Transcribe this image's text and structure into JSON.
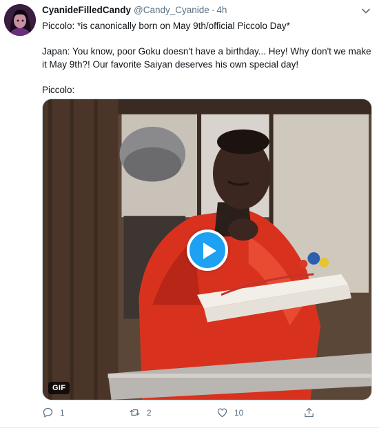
{
  "tweet": {
    "author": {
      "display_name": "CyanideFilledCandy",
      "handle": "@Candy_Cyanide",
      "separator": "·",
      "time": "4h",
      "avatar_icon": "avatar-image"
    },
    "menu_icon": "chevron-down-icon",
    "text": {
      "line1": "Piccolo: *is canonically born on May 9th/official Piccolo Day*",
      "line2": "Japan: You know, poor Goku doesn't have a birthday... Hey! Why don't we make it May 9th?! Our favorite Saiyan deserves his own special day!",
      "line3": "Piccolo:"
    },
    "media": {
      "badge": "GIF",
      "play_icon": "play-icon"
    },
    "actions": {
      "reply": {
        "icon": "reply-icon",
        "count": "1"
      },
      "retweet": {
        "icon": "retweet-icon",
        "count": "2"
      },
      "like": {
        "icon": "heart-icon",
        "count": "10"
      },
      "share": {
        "icon": "share-icon"
      }
    },
    "colors": {
      "accent": "#1da1f2",
      "secondary_text": "#5b7083",
      "primary_text": "#0f1419"
    }
  }
}
